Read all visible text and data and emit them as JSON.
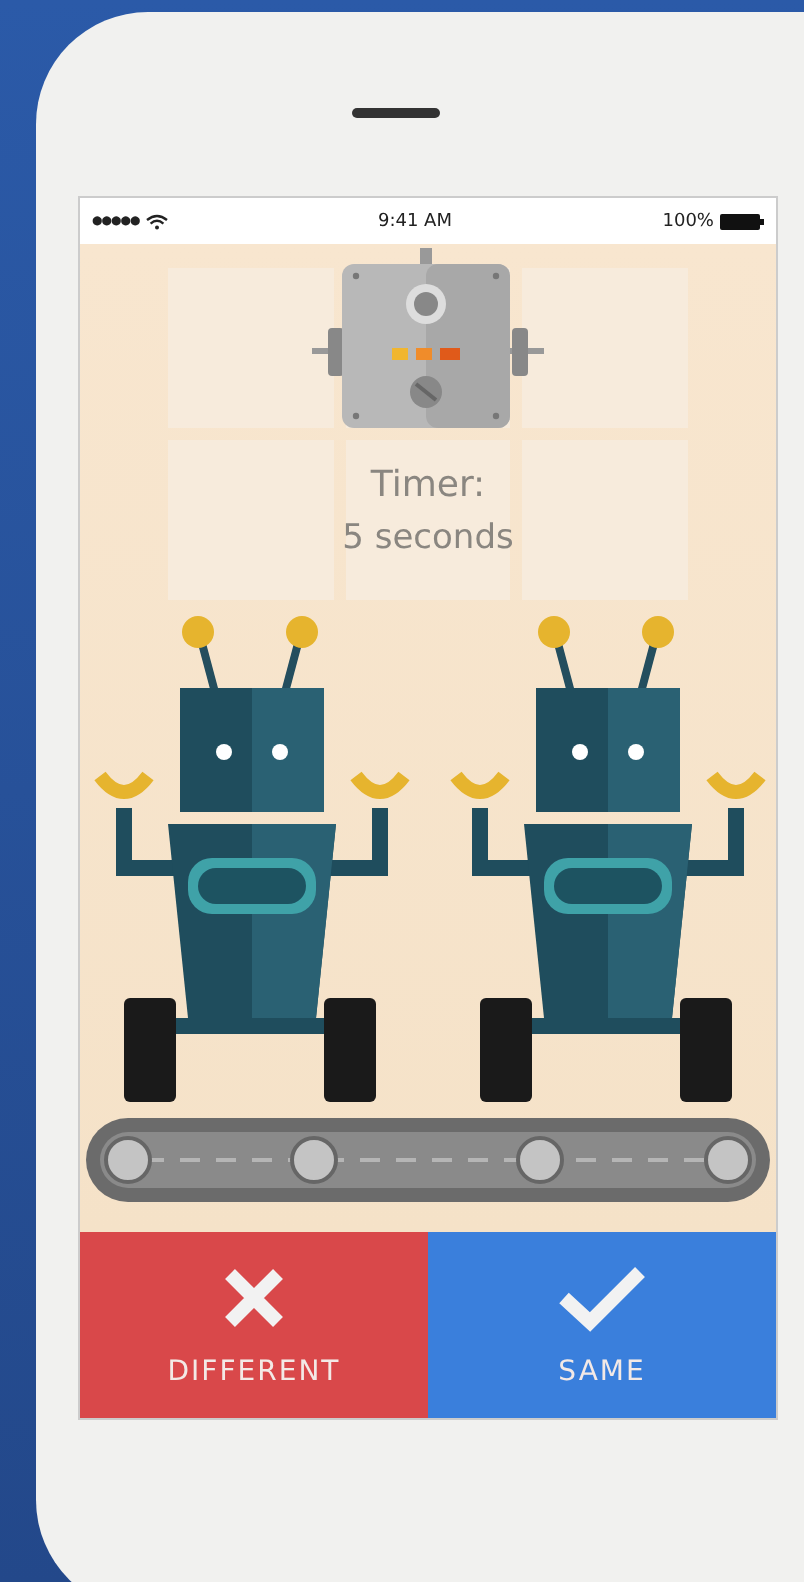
{
  "status_bar": {
    "signal": "●●●●●",
    "time": "9:41 AM",
    "battery": "100%"
  },
  "timer": {
    "label": "Timer:",
    "value": "5 seconds"
  },
  "buttons": [
    {
      "kind": "different",
      "label": "DIFFERENT"
    },
    {
      "kind": "same",
      "label": "SAME"
    }
  ]
}
